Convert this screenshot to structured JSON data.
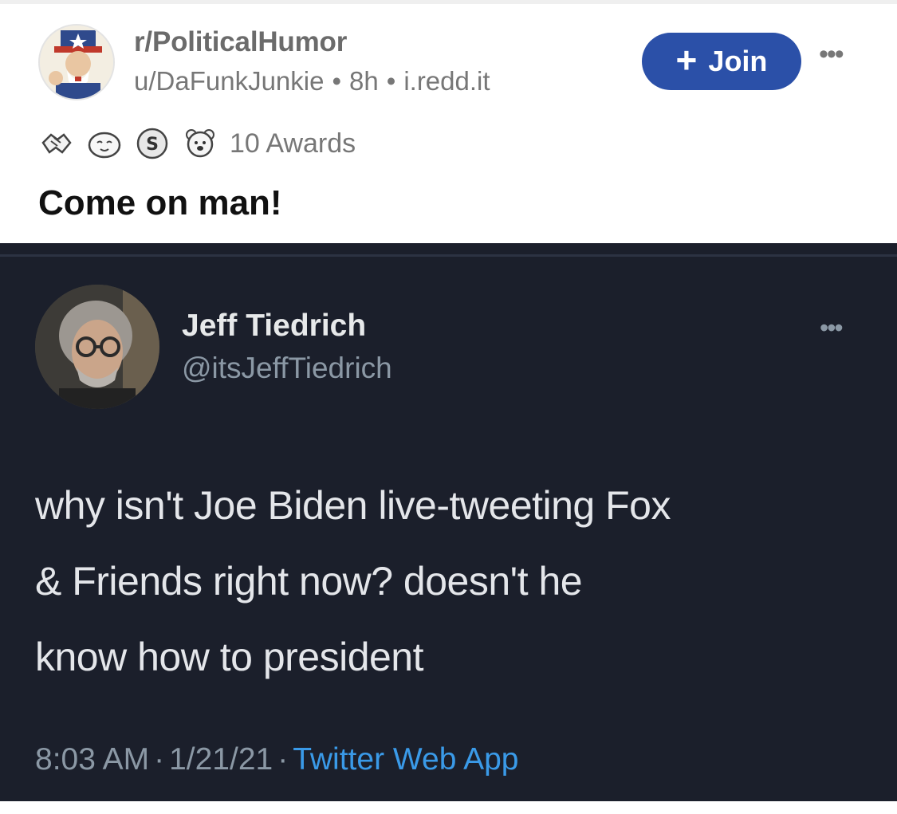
{
  "post": {
    "subreddit": "r/PoliticalHumor",
    "author": "u/DaFunkJunkie",
    "age": "8h",
    "domain": "i.redd.it",
    "join_label": "Join",
    "awards_label": "10 Awards",
    "title": "Come on man!"
  },
  "tweet": {
    "name": "Jeff Tiedrich",
    "handle": "@itsJeffTiedrich",
    "text_lines": [
      "why isn't Joe Biden live-tweeting Fox",
      "& Friends right now? doesn't he",
      "know how to president"
    ],
    "time": "8:03 AM",
    "date": "1/21/21",
    "app": "Twitter Web App"
  },
  "colors": {
    "join_button": "#2b50a8",
    "tweet_background": "#1b1f2b",
    "link_blue": "#3a9ae8"
  },
  "icons": {
    "award_1": "handshake-award-icon",
    "award_2": "face-award-icon",
    "award_3": "silver-coin-award-icon",
    "award_4": "bear-award-icon"
  }
}
